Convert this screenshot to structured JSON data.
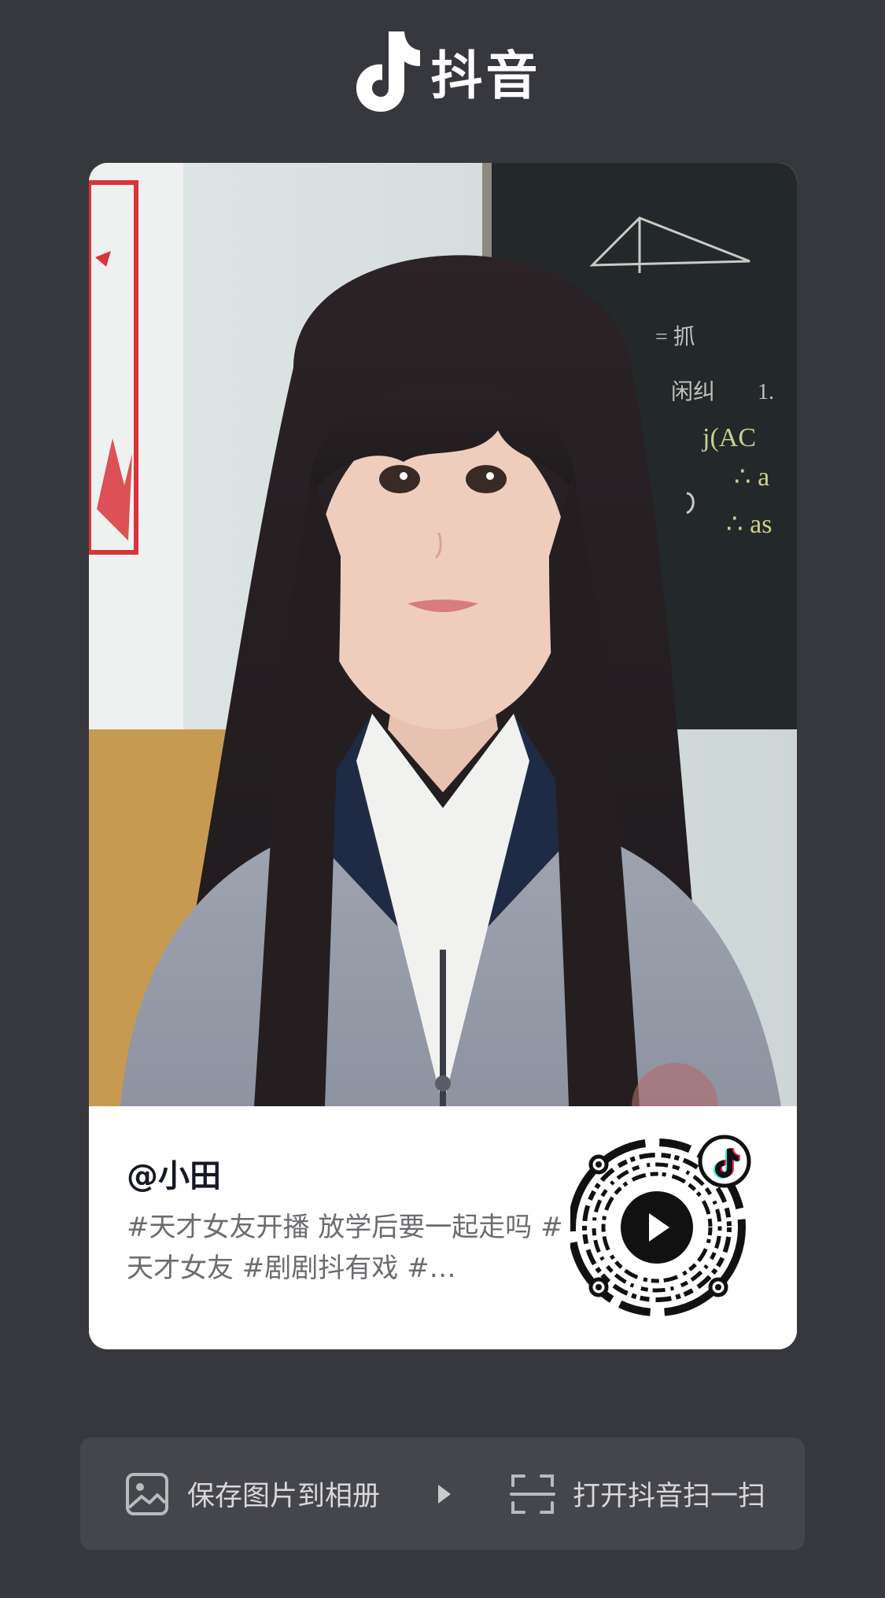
{
  "brand": {
    "name": "抖音",
    "icon": "douyin-note-logo"
  },
  "video_card": {
    "author": "@小田",
    "description": "#天才女友开播 放学后要一起走吗 #天才女友 #剧剧抖有戏 #…",
    "qr_center_icon": "play-icon",
    "qr_badge_icon": "douyin-note-logo"
  },
  "actions": {
    "save_label": "保存图片到相册",
    "save_icon": "image-icon",
    "separator_icon": "triangle-right-icon",
    "scan_label": "打开抖音扫一扫",
    "scan_icon": "scan-icon"
  },
  "colors": {
    "background": "#37383d",
    "action_bar": "#45464b",
    "card": "#ffffff",
    "author_text": "#161823",
    "desc_text": "#6b6c70"
  }
}
